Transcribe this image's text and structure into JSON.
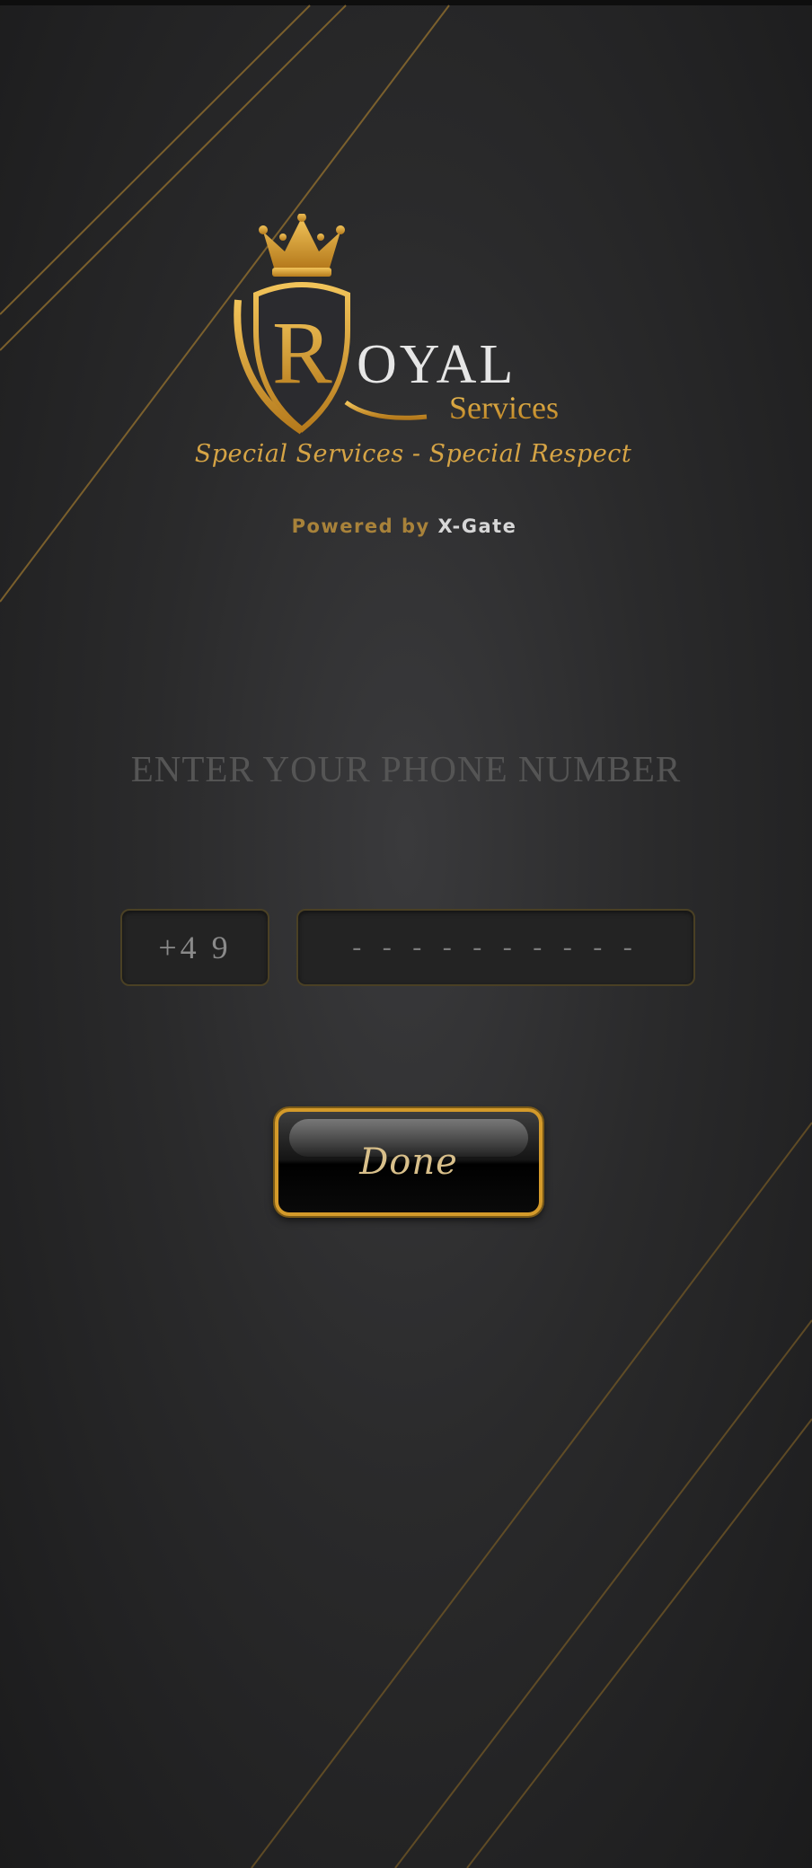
{
  "brand": {
    "logo_letter": "R",
    "logo_word": "OYAL",
    "logo_sub": "Services",
    "tagline": "Special Services - Special Respect",
    "powered_prefix": "Powered by",
    "powered_name": "X-Gate"
  },
  "form": {
    "heading": "ENTER YOUR PHONE NUMBER",
    "country_code": "+4 9",
    "phone_placeholder": "- - - - - - - - - -",
    "phone_value": "",
    "done_label": "Done"
  },
  "colors": {
    "gold": "#d49a2a",
    "background": "#2a2a2b"
  },
  "icons": {
    "logo": "crown-shield-logo-icon"
  }
}
